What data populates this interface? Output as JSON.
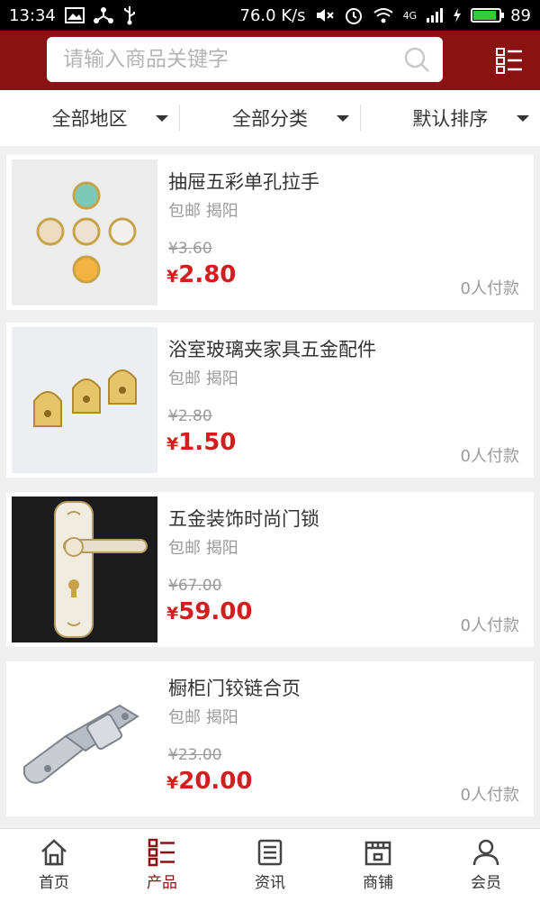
{
  "status_bar": {
    "time": "13:34",
    "speed": "76.0 K/s",
    "network": "4G",
    "battery": "89",
    "battery_level": 0.89
  },
  "header": {
    "search_placeholder": "请输入商品关键字",
    "icons": [
      "search-icon",
      "menu-list-icon"
    ]
  },
  "filters": [
    {
      "label": "全部地区"
    },
    {
      "label": "全部分类"
    },
    {
      "label": "默认排序"
    }
  ],
  "products": [
    {
      "title": "抽屉五彩单孔拉手",
      "location": "包邮 揭阳",
      "old_price": "¥3.60",
      "yen": "¥",
      "price": "2.80",
      "paid": "0人付款"
    },
    {
      "title": "浴室玻璃夹家具五金配件",
      "location": "包邮 揭阳",
      "old_price": "¥2.80",
      "yen": "¥",
      "price": "1.50",
      "paid": "0人付款"
    },
    {
      "title": "五金装饰时尚门锁",
      "location": "包邮 揭阳",
      "old_price": "¥67.00",
      "yen": "¥",
      "price": "59.00",
      "paid": "0人付款"
    },
    {
      "title": "橱柜门铰链合页",
      "location": "包邮 揭阳",
      "old_price": "¥23.00",
      "yen": "¥",
      "price": "20.00",
      "paid": "0人付款"
    }
  ],
  "bottom_nav": [
    {
      "label": "首页",
      "icon": "home-icon",
      "active": false
    },
    {
      "label": "产品",
      "icon": "product-list-icon",
      "active": true
    },
    {
      "label": "资讯",
      "icon": "news-icon",
      "active": false
    },
    {
      "label": "商铺",
      "icon": "store-icon",
      "active": false
    },
    {
      "label": "会员",
      "icon": "user-icon",
      "active": false
    }
  ],
  "colors": {
    "brand": "#8b1212",
    "price": "#d01f1f",
    "muted": "#9a9a9a"
  }
}
